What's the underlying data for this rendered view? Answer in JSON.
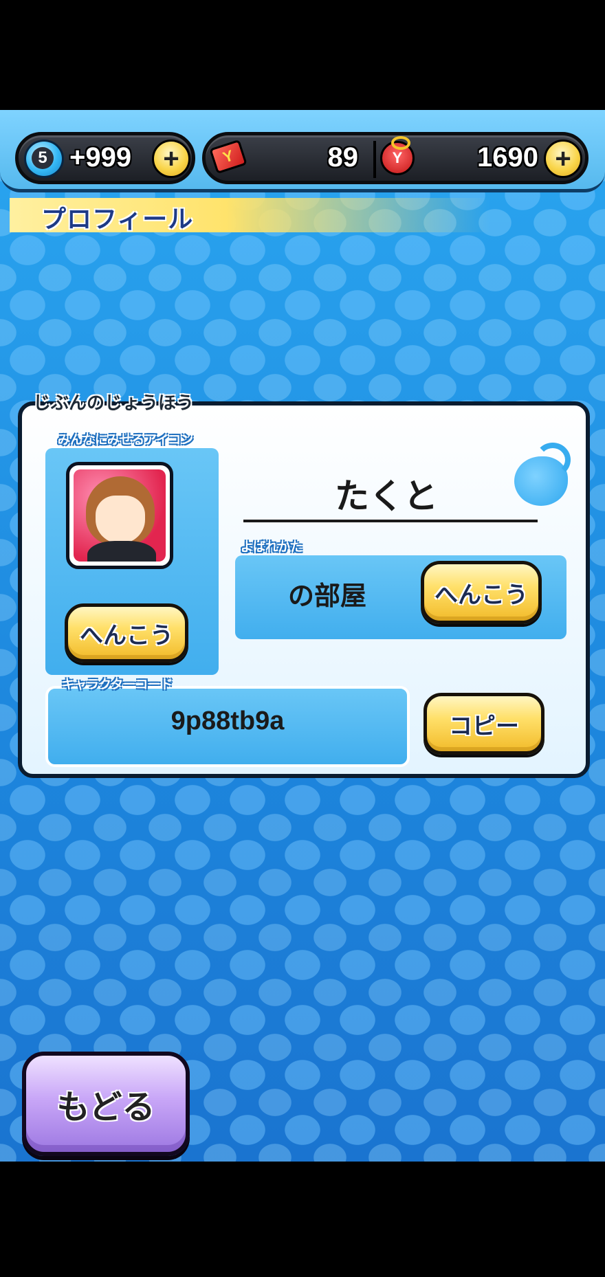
{
  "topbar": {
    "level": "5",
    "stamina": "+999",
    "tickets": "89",
    "money": "1690",
    "plus_label": "+",
    "ticket_icon_glyph": "Y",
    "purse_icon_glyph": "Y"
  },
  "screen_title": "プロフィール",
  "profile": {
    "section_label": "じぶんのじょうほう",
    "icon_label": "みんなにみせるアイコン",
    "icon_change_label": "へんこう",
    "name": "たくと",
    "title_label": "よばれかた",
    "title_value": "の部屋",
    "title_change_label": "へんこう",
    "code_label": "キャラクターコード",
    "code_value": "9p88tb9a",
    "copy_label": "コピー"
  },
  "back_label": "もどる",
  "colors": {
    "background_blue": "#1d86dd",
    "gold_button": "#ffe06a",
    "purple_button": "#c8a6f7",
    "panel": "#e3f4ff"
  }
}
